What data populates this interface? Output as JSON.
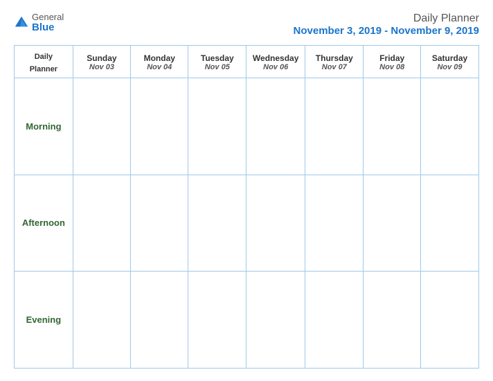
{
  "logo": {
    "general": "General",
    "blue": "Blue"
  },
  "header": {
    "title": "Daily Planner",
    "date_range": "November 3, 2019 - November 9, 2019"
  },
  "table": {
    "col_header_label": "Daily\nPlanner",
    "columns": [
      {
        "day": "Sunday",
        "date": "Nov 03"
      },
      {
        "day": "Monday",
        "date": "Nov 04"
      },
      {
        "day": "Tuesday",
        "date": "Nov 05"
      },
      {
        "day": "Wednesday",
        "date": "Nov 06"
      },
      {
        "day": "Thursday",
        "date": "Nov 07"
      },
      {
        "day": "Friday",
        "date": "Nov 08"
      },
      {
        "day": "Saturday",
        "date": "Nov 09"
      }
    ],
    "rows": [
      {
        "label": "Morning"
      },
      {
        "label": "Afternoon"
      },
      {
        "label": "Evening"
      }
    ]
  }
}
